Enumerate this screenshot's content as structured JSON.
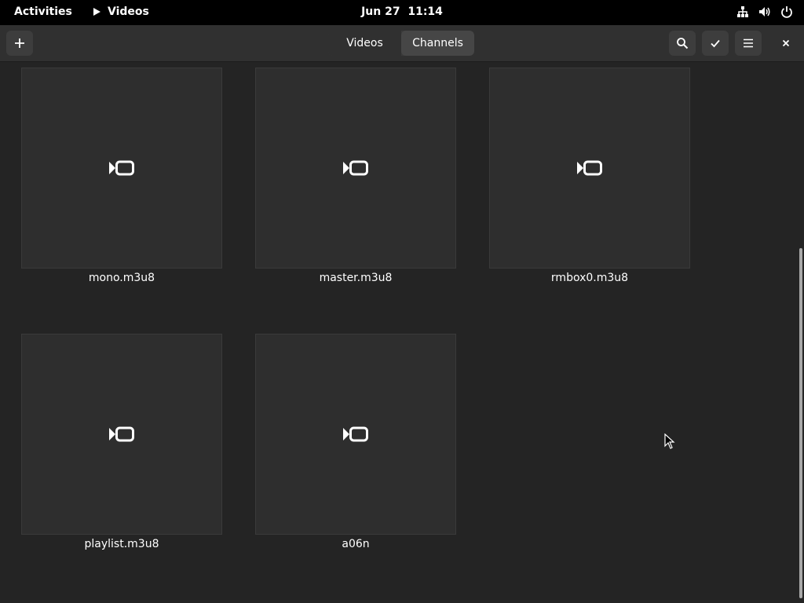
{
  "topbar": {
    "activities_label": "Activities",
    "app_name": "Videos",
    "clock": "Jun 27  11:14",
    "tray_icons": [
      "network-icon",
      "volume-icon",
      "power-icon"
    ]
  },
  "header": {
    "add_icon": "plus-icon",
    "tabs": [
      {
        "label": "Videos",
        "active": true
      },
      {
        "label": "Channels",
        "active": false
      }
    ],
    "right_icons": [
      "search-icon",
      "checkmark-icon",
      "hamburger-menu-icon",
      "close-icon"
    ]
  },
  "videos": [
    {
      "name": "mono.m3u8"
    },
    {
      "name": "master.m3u8"
    },
    {
      "name": "rmbox0.m3u8"
    },
    {
      "name": "playlist.m3u8"
    },
    {
      "name": "a06n"
    }
  ],
  "colors": {
    "topbar_bg": "#000000",
    "headerbar_bg": "#303030",
    "content_bg": "#242424",
    "thumb_bg": "#2e2e2e",
    "text": "#ffffff"
  }
}
